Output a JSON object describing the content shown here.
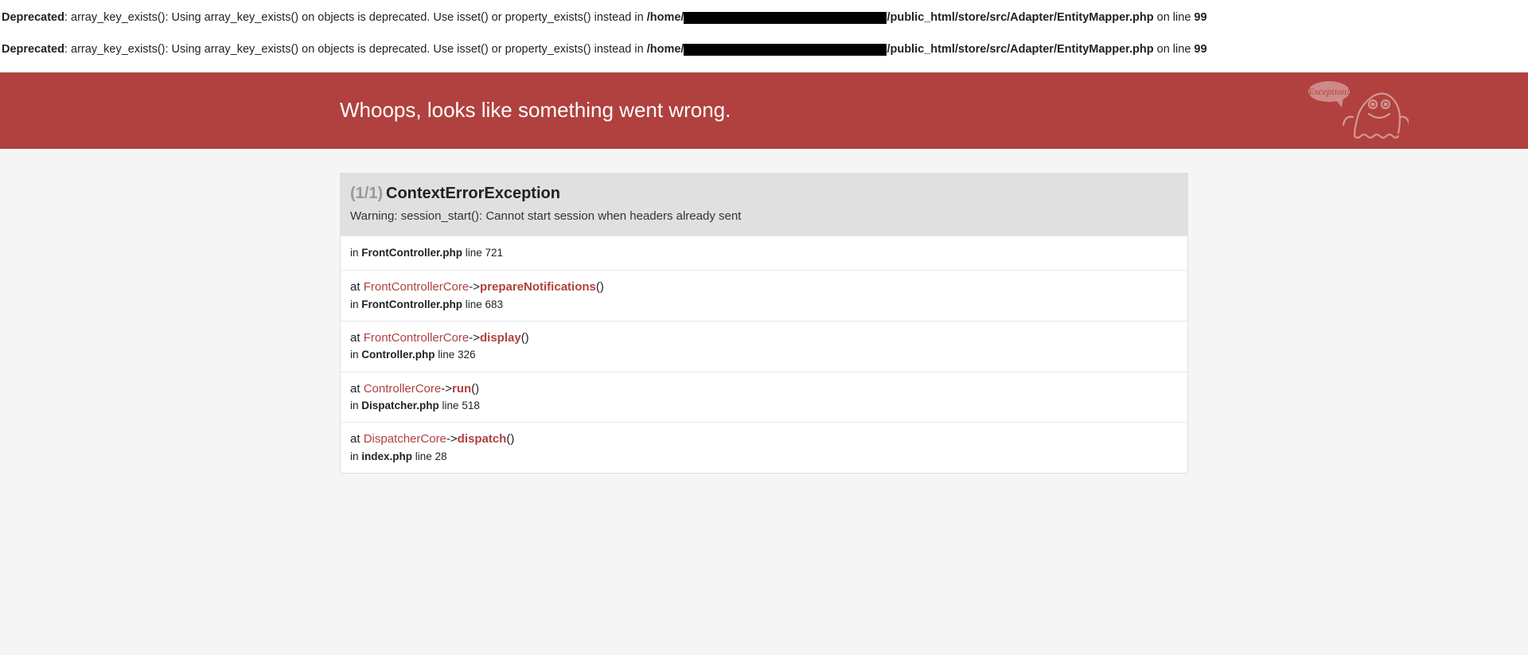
{
  "deprecated": [
    {
      "label": "Deprecated",
      "msg": ": array_key_exists(): Using array_key_exists() on objects is deprecated. Use isset() or property_exists() instead in ",
      "path_pre": "/home/",
      "path_post": "/public_html/store/src/Adapter/EntityMapper.php",
      "on_line": " on line ",
      "line": "99"
    },
    {
      "label": "Deprecated",
      "msg": ": array_key_exists(): Using array_key_exists() on objects is deprecated. Use isset() or property_exists() instead in ",
      "path_pre": "/home/",
      "path_post": "/public_html/store/src/Adapter/EntityMapper.php",
      "on_line": " on line ",
      "line": "99"
    }
  ],
  "header": {
    "title": "Whoops, looks like something went wrong.",
    "bubble_text": "Exception!"
  },
  "exception": {
    "count": "(1/1)",
    "name": "ContextErrorException",
    "message": "Warning: session_start(): Cannot start session when headers already sent"
  },
  "trace": [
    {
      "top": {
        "in": "in ",
        "file": "FrontController.php",
        "line": " line 721"
      }
    },
    {
      "call": {
        "at": "at ",
        "class": "FrontControllerCore",
        "arrow": "->",
        "method": "prepareNotifications",
        "paren": "()"
      },
      "loc": {
        "in": "in ",
        "file": "FrontController.php",
        "line": " line 683"
      }
    },
    {
      "call": {
        "at": "at ",
        "class": "FrontControllerCore",
        "arrow": "->",
        "method": "display",
        "paren": "()"
      },
      "loc": {
        "in": "in ",
        "file": "Controller.php",
        "line": " line 326"
      }
    },
    {
      "call": {
        "at": "at ",
        "class": "ControllerCore",
        "arrow": "->",
        "method": "run",
        "paren": "()"
      },
      "loc": {
        "in": "in ",
        "file": "Dispatcher.php",
        "line": " line 518"
      }
    },
    {
      "call": {
        "at": "at ",
        "class": "DispatcherCore",
        "arrow": "->",
        "method": "dispatch",
        "paren": "()"
      },
      "loc": {
        "in": "in ",
        "file": "index.php",
        "line": " line 28"
      }
    }
  ]
}
